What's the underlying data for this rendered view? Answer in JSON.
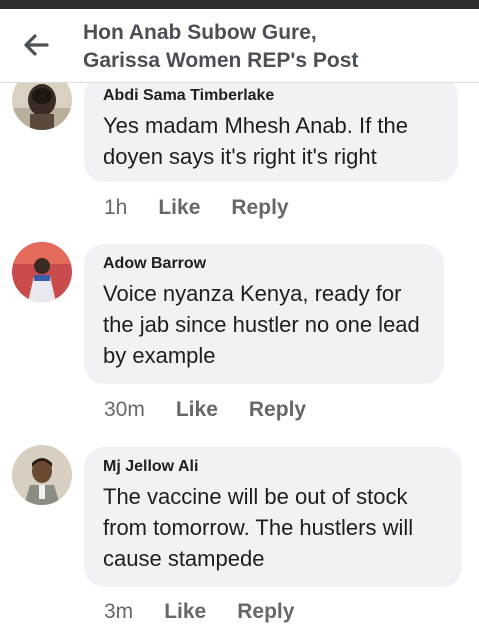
{
  "header": {
    "title_line1": "Hon Anab Subow Gure,",
    "title_line2": "Garissa Women REP's Post"
  },
  "comments": [
    {
      "author": "Abdi Sama Timberlake",
      "text": "Yes madam Mhesh Anab. If the doyen says it's right it's right",
      "time": "1h",
      "like_label": "Like",
      "reply_label": "Reply"
    },
    {
      "author": "Adow Barrow",
      "text": "Voice nyanza Kenya, ready for the jab since hustler no one lead by example",
      "time": "30m",
      "like_label": "Like",
      "reply_label": "Reply"
    },
    {
      "author": "Mj Jellow Ali",
      "text": "The vaccine will be out of stock from tomorrow. The hustlers will cause stampede",
      "time": "3m",
      "like_label": "Like",
      "reply_label": "Reply"
    }
  ]
}
